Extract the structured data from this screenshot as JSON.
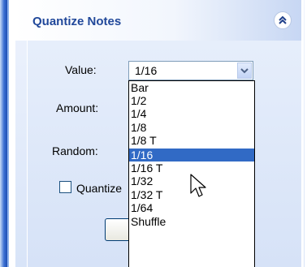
{
  "panel": {
    "title": "Quantize Notes",
    "collapse_icon": "chevron-double-up-icon"
  },
  "form": {
    "value_label": "Value:",
    "value_selected": "1/16",
    "amount_label": "Amount:",
    "random_label": "Random:",
    "quantize_checkbox_label": "Quantize",
    "quantize_checked": false
  },
  "dropdown": {
    "options": [
      "Bar",
      "1/2",
      "1/4",
      "1/8",
      "1/8 T",
      "1/16",
      "1/16 T",
      "1/32",
      "1/32 T",
      "1/64",
      "Shuffle"
    ],
    "highlighted": "1/16"
  },
  "colors": {
    "title": "#21489a",
    "highlight": "#316ac5"
  }
}
